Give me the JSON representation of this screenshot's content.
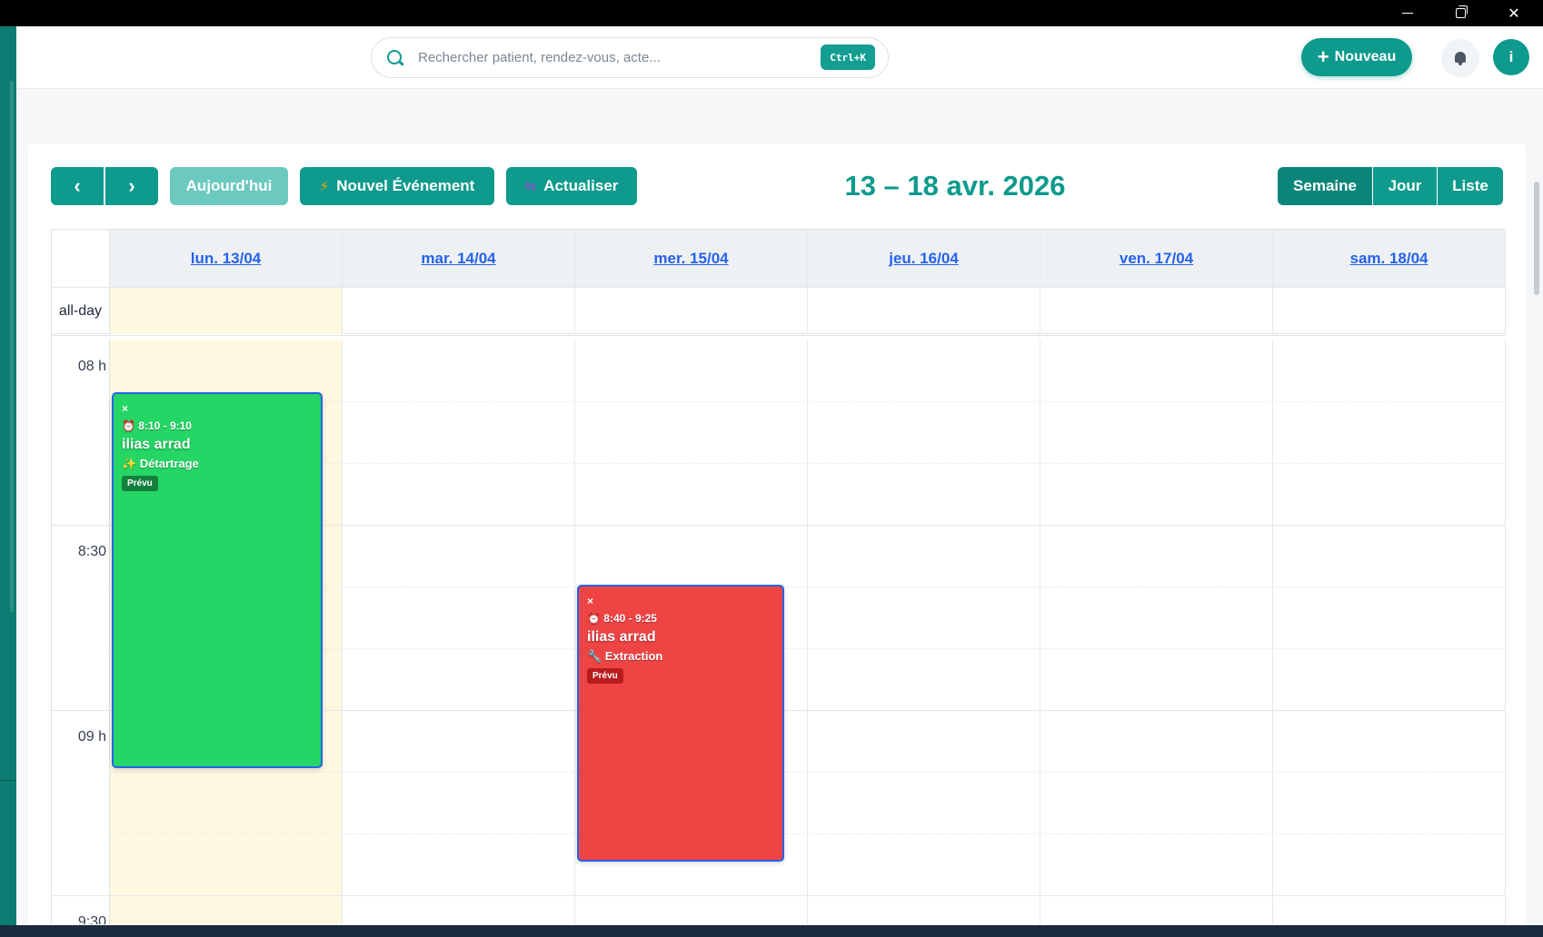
{
  "window": {
    "minimize": "minimize",
    "maximize": "maximize",
    "close": "close"
  },
  "header": {
    "search_placeholder": "Rechercher patient, rendez-vous, acte...",
    "search_shortcut": "Ctrl+K",
    "new_label": "Nouveau",
    "avatar_initial": "i"
  },
  "toolbar": {
    "today_label": "Aujourd'hui",
    "new_event_label": "Nouvel Événement",
    "refresh_label": "Actualiser",
    "range_title": "13 – 18 avr. 2026",
    "views": {
      "week": "Semaine",
      "day": "Jour",
      "list": "Liste"
    },
    "colors": {
      "primary": "#0e9a8d",
      "today_button": "#6cc9c0"
    }
  },
  "calendar": {
    "all_day_label": "all-day",
    "days": [
      {
        "label": "lun. 13/04",
        "today": true
      },
      {
        "label": "mar. 14/04",
        "today": false
      },
      {
        "label": "mer. 15/04",
        "today": false
      },
      {
        "label": "jeu. 16/04",
        "today": false
      },
      {
        "label": "ven. 17/04",
        "today": false
      },
      {
        "label": "sam. 18/04",
        "today": false
      }
    ],
    "time_labels": [
      "08 h",
      "8:30",
      "09 h",
      "9:30"
    ],
    "events": [
      {
        "close": "×",
        "time": "⏰ 8:10 - 9:10",
        "patient": "ilias arrad",
        "act": "✨ Détartrage",
        "status": "Prévu",
        "color": "#25d565"
      },
      {
        "close": "×",
        "time": "⏰ 8:40 - 9:25",
        "patient": "ilias arrad",
        "act": "🔧 Extraction",
        "status": "Prévu",
        "color": "#ef4444"
      }
    ]
  }
}
